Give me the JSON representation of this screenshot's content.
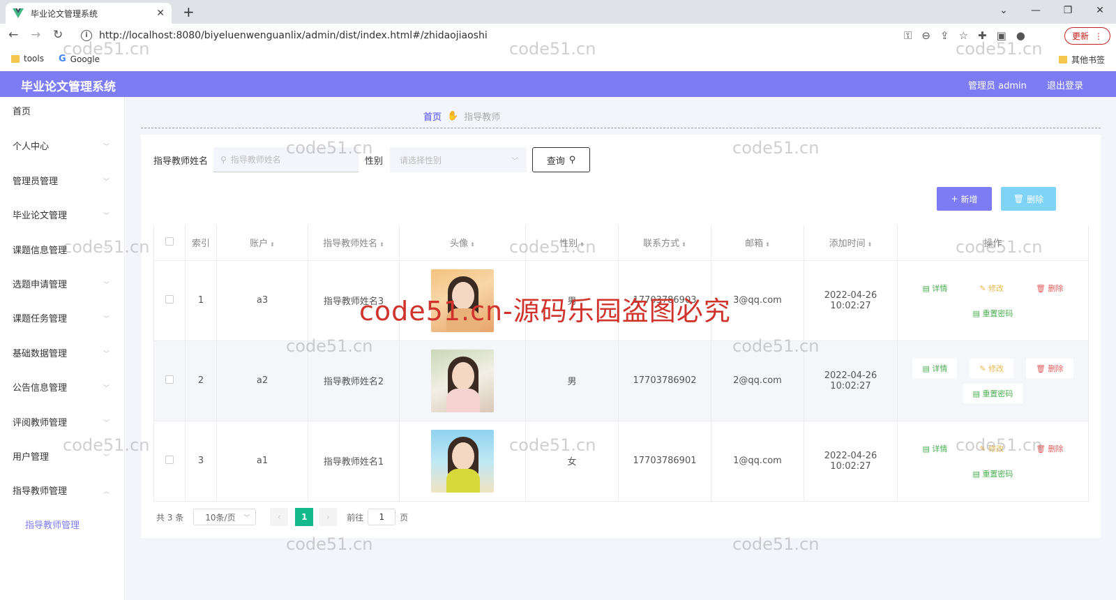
{
  "browser": {
    "tab_title": "毕业论文管理系统",
    "url": "http://localhost:8080/biyeluenwenguanlix/admin/dist/index.html#/zhidaojiaoshi",
    "update_label": "更新",
    "bookmarks": [
      "tools",
      "Google"
    ],
    "other_bookmarks": "其他书签"
  },
  "header": {
    "title": "毕业论文管理系统",
    "user": "管理员 admin",
    "logout": "退出登录",
    "accent": "#7d7cf4"
  },
  "sidebar": {
    "items": [
      {
        "label": "首页"
      },
      {
        "label": "个人中心"
      },
      {
        "label": "管理员管理"
      },
      {
        "label": "毕业论文管理"
      },
      {
        "label": "课题信息管理"
      },
      {
        "label": "选题申请管理"
      },
      {
        "label": "课题任务管理"
      },
      {
        "label": "基础数据管理"
      },
      {
        "label": "公告信息管理"
      },
      {
        "label": "评阅教师管理"
      },
      {
        "label": "用户管理"
      },
      {
        "label": "指导教师管理"
      }
    ],
    "active_sub": "指导教师管理"
  },
  "breadcrumb": {
    "home": "首页",
    "current": "指导教师"
  },
  "search": {
    "name_label": "指导教师姓名",
    "name_placeholder": "指导教师姓名",
    "gender_label": "性别",
    "gender_placeholder": "请选择性别",
    "query_label": "查询"
  },
  "actions": {
    "add": "新增",
    "delete": "删除"
  },
  "table": {
    "columns": [
      "索引",
      "账户",
      "指导教师姓名",
      "头像",
      "性别",
      "联系方式",
      "邮箱",
      "添加时间",
      "操作"
    ],
    "rows": [
      {
        "index": "1",
        "account": "a3",
        "name": "指导教师姓名3",
        "gender": "男",
        "phone": "17703786903",
        "email": "3@qq.com",
        "time": "2022-04-26 10:02:27"
      },
      {
        "index": "2",
        "account": "a2",
        "name": "指导教师姓名2",
        "gender": "男",
        "phone": "17703786902",
        "email": "2@qq.com",
        "time": "2022-04-26 10:02:27"
      },
      {
        "index": "3",
        "account": "a1",
        "name": "指导教师姓名1",
        "gender": "女",
        "phone": "17703786901",
        "email": "1@qq.com",
        "time": "2022-04-26 10:02:27"
      }
    ],
    "ops": {
      "detail": "详情",
      "edit": "修改",
      "remove": "删除",
      "reset": "重置密码"
    }
  },
  "pager": {
    "total": "共 3 条",
    "size": "10条/页",
    "page": "1",
    "goto_prefix": "前往",
    "goto_value": "1",
    "goto_suffix": "页"
  },
  "watermarks": {
    "small": "code51.cn",
    "big": "code51.cn-源码乐园盗图必究"
  }
}
